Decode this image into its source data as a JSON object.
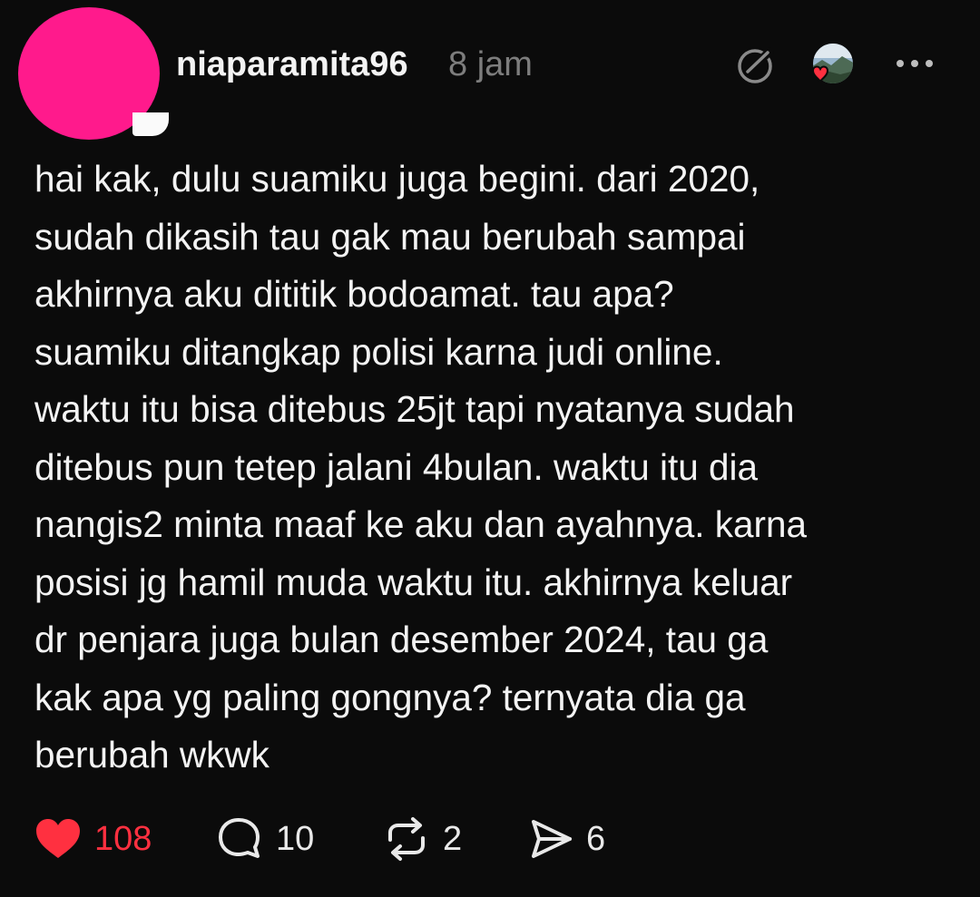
{
  "post": {
    "username": "niaparamita96",
    "timestamp": "8 jam",
    "avatar_color": "#ff1a8c",
    "body_lines": [
      "hai kak, dulu suamiku juga begini. dari 2020,",
      "sudah dikasih tau gak mau berubah sampai",
      "akhirnya aku dititik bodoamat. tau apa?",
      "suamiku ditangkap polisi karna judi online.",
      "waktu itu bisa ditebus 25jt tapi nyatanya sudah",
      "ditebus pun tetep jalani 4bulan. waktu itu dia",
      "nangis2 minta maaf ke aku dan ayahnya. karna",
      "posisi jg hamil muda waktu itu. akhirnya keluar",
      "dr penjara juga bulan desember 2024, tau ga",
      "kak apa yg paling gongnya? ternyata dia ga",
      "berubah wkwk"
    ]
  },
  "actions": {
    "like": {
      "icon": "heart-filled-icon",
      "count": "108",
      "color": "#ff3040"
    },
    "reply": {
      "icon": "speech-bubble-icon",
      "count": "10"
    },
    "repost": {
      "icon": "repost-icon",
      "count": "2"
    },
    "share": {
      "icon": "send-icon",
      "count": "6"
    }
  },
  "header_icons": [
    "edit-circle-icon",
    "liker-avatar",
    "more-horizontal-icon"
  ],
  "colors": {
    "background": "#0b0b0b",
    "text": "#f3f3f3",
    "muted": "#7d7d7d",
    "like": "#ff3040"
  }
}
